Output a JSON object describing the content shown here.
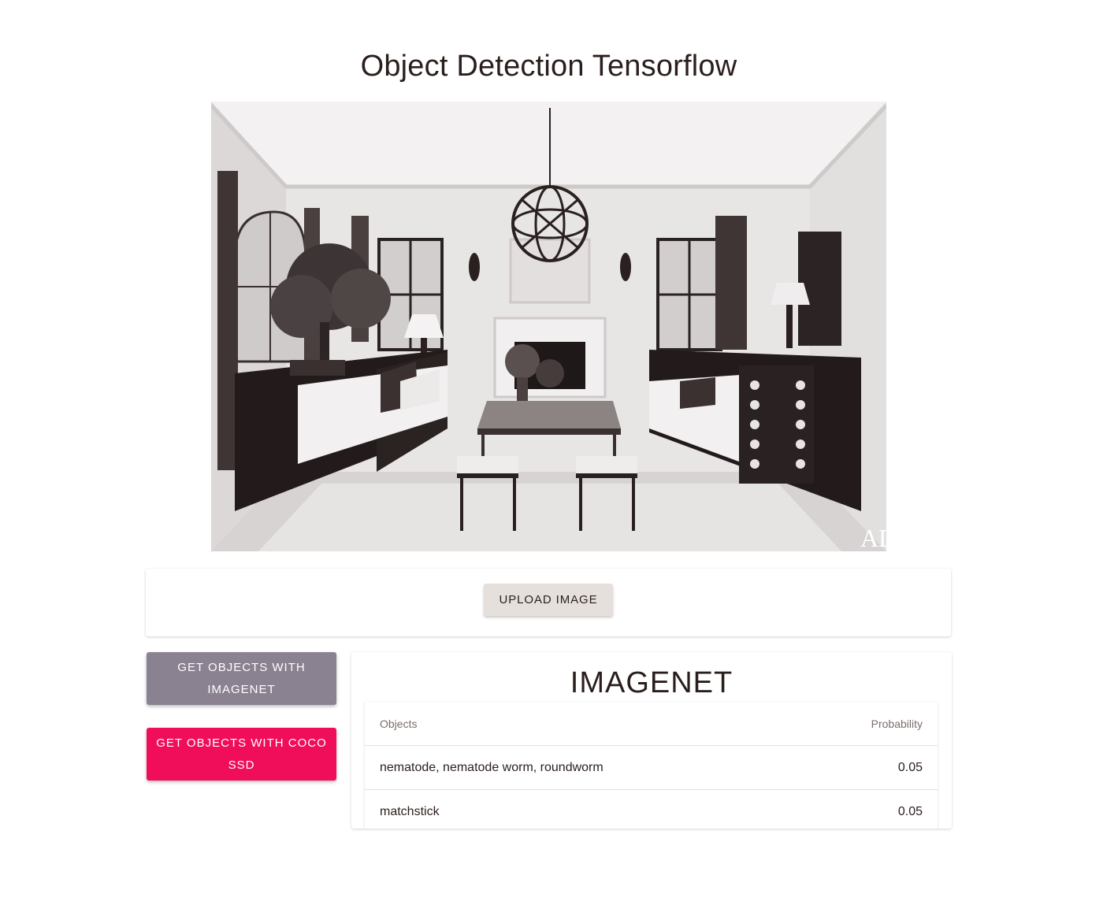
{
  "header": {
    "title": "Object Detection Tensorflow"
  },
  "image": {
    "watermark": "AD"
  },
  "upload": {
    "button_label": "UPLOAD IMAGE"
  },
  "actions": {
    "imagenet_label": "GET OBJECTS WITH IMAGENET",
    "coco_label": "GET OBJECTS WITH COCO SSD"
  },
  "results": {
    "heading": "IMAGENET",
    "columns": [
      "Objects",
      "Probability"
    ],
    "rows": [
      {
        "object": "nematode, nematode worm, roundworm",
        "probability": "0.05"
      },
      {
        "object": "matchstick",
        "probability": "0.05"
      }
    ]
  },
  "colors": {
    "imagenet_button": "#8a8290",
    "coco_button": "#f00d5a",
    "upload_button": "#e6e0dd"
  }
}
